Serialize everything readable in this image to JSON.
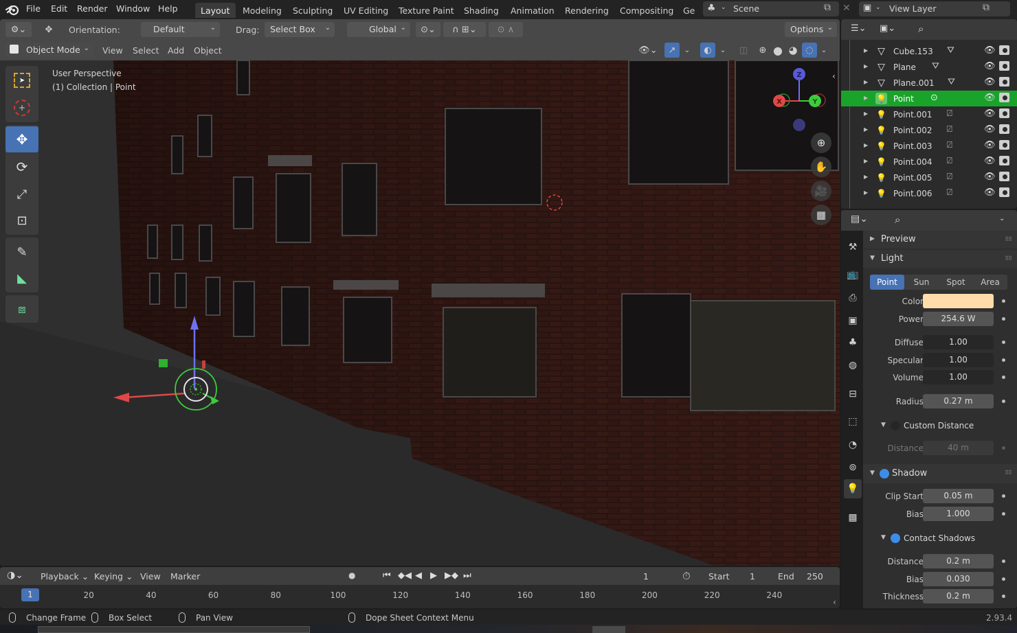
{
  "topbar": {
    "menus": [
      "File",
      "Edit",
      "Render",
      "Window",
      "Help"
    ],
    "workspaces": [
      "Layout",
      "Modeling",
      "Sculpting",
      "UV Editing",
      "Texture Paint",
      "Shading",
      "Animation",
      "Rendering",
      "Compositing",
      "Ge"
    ],
    "active_workspace": "Layout",
    "scene": "Scene",
    "view_layer": "View Layer"
  },
  "viewport": {
    "header": {
      "orientation_label": "Orientation:",
      "orientation_value": "Default",
      "drag_label": "Drag:",
      "drag_value": "Select Box",
      "transform_space": "Global",
      "options_label": "Options",
      "mode": "Object Mode",
      "menus": [
        "View",
        "Select",
        "Add",
        "Object"
      ]
    },
    "overlay_text": {
      "line1": "User Perspective",
      "line2": "(1) Collection | Point"
    },
    "gizmo": {
      "x": "X",
      "y": "Y",
      "z": "Z"
    },
    "colors": {
      "accent": "#4772b3",
      "x_axis": "#e04848",
      "y_axis": "#3ecb3e",
      "z_axis": "#5a5ad8",
      "selection": "#1aa32b"
    }
  },
  "outliner": {
    "rows": [
      {
        "name": "Cube.153",
        "type": "mesh",
        "selected": false
      },
      {
        "name": "Plane",
        "type": "mesh",
        "selected": false
      },
      {
        "name": "Plane.001",
        "type": "mesh",
        "selected": false
      },
      {
        "name": "Point",
        "type": "light",
        "selected": true
      },
      {
        "name": "Point.001",
        "type": "light",
        "selected": false
      },
      {
        "name": "Point.002",
        "type": "light",
        "selected": false
      },
      {
        "name": "Point.003",
        "type": "light",
        "selected": false
      },
      {
        "name": "Point.004",
        "type": "light",
        "selected": false
      },
      {
        "name": "Point.005",
        "type": "light",
        "selected": false
      },
      {
        "name": "Point.006",
        "type": "light",
        "selected": false
      }
    ]
  },
  "properties": {
    "preview_label": "Preview",
    "light_label": "Light",
    "light_types": [
      "Point",
      "Sun",
      "Spot",
      "Area"
    ],
    "active_light_type": "Point",
    "color_label": "Color",
    "color_value": "#ffdcaa",
    "power_label": "Power",
    "power_value": "254.6 W",
    "diffuse_label": "Diffuse",
    "diffuse_value": "1.00",
    "specular_label": "Specular",
    "specular_value": "1.00",
    "volume_label": "Volume",
    "volume_value": "1.00",
    "radius_label": "Radius",
    "radius_value": "0.27 m",
    "custom_distance_label": "Custom Distance",
    "custom_distance_enabled": false,
    "distance_label": "Distance",
    "distance_value": "40 m",
    "shadow_label": "Shadow",
    "shadow_enabled": true,
    "clip_start_label": "Clip Start",
    "clip_start_value": "0.05 m",
    "bias_label": "Bias",
    "bias_value": "1.000",
    "contact_shadows_label": "Contact Shadows",
    "contact_shadows_enabled": true,
    "cs_distance_label": "Distance",
    "cs_distance_value": "0.2 m",
    "cs_bias_label": "Bias",
    "cs_bias_value": "0.030",
    "cs_thickness_label": "Thickness",
    "cs_thickness_value": "0.2 m"
  },
  "timeline": {
    "menus": [
      "Playback",
      "Keying",
      "View",
      "Marker"
    ],
    "current_frame": "1",
    "start_label": "Start",
    "start_value": "1",
    "end_label": "End",
    "end_value": "250",
    "ticks": [
      "20",
      "40",
      "60",
      "80",
      "100",
      "120",
      "140",
      "160",
      "180",
      "200",
      "220",
      "240"
    ],
    "cursor_frame": "1"
  },
  "statusbar": {
    "hints": [
      "Change Frame",
      "Box Select",
      "Pan View",
      "Dope Sheet Context Menu"
    ],
    "version": "2.93.4"
  }
}
